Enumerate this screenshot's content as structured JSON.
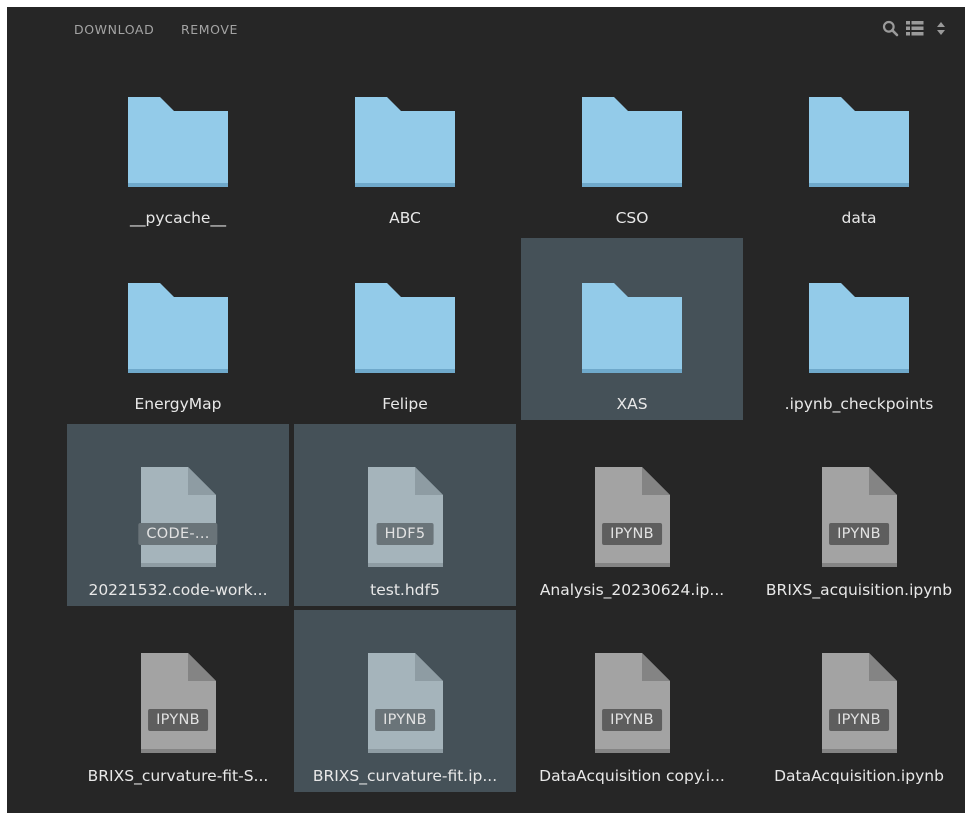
{
  "toolbar": {
    "download_label": "DOWNLOAD",
    "remove_label": "REMOVE",
    "icons": [
      "search-icon",
      "list-view-icon",
      "sort-icon"
    ]
  },
  "colors": {
    "panel_bg": "#262626",
    "selected_bg": "#455158",
    "folder": "#93cbe9",
    "doc": "#a3a3a3",
    "doc_selected": "#a5b4bb"
  },
  "files": [
    {
      "name": "__pycache__",
      "type": "folder",
      "selected": false
    },
    {
      "name": "ABC",
      "type": "folder",
      "selected": false
    },
    {
      "name": "CSO",
      "type": "folder",
      "selected": false
    },
    {
      "name": "data",
      "type": "folder",
      "selected": false
    },
    {
      "name": "EnergyMap",
      "type": "folder",
      "selected": false
    },
    {
      "name": "Felipe",
      "type": "folder",
      "selected": false
    },
    {
      "name": "XAS",
      "type": "folder",
      "selected": true
    },
    {
      "name": ".ipynb_checkpoints",
      "type": "folder",
      "selected": false
    },
    {
      "name": "20221532.code-work...",
      "type": "file",
      "badge": "CODE-...",
      "selected": true
    },
    {
      "name": "test.hdf5",
      "type": "file",
      "badge": "HDF5",
      "selected": true
    },
    {
      "name": "Analysis_20230624.ip...",
      "type": "file",
      "badge": "IPYNB",
      "selected": false
    },
    {
      "name": "BRIXS_acquisition.ipynb",
      "type": "file",
      "badge": "IPYNB",
      "selected": false
    },
    {
      "name": "BRIXS_curvature-fit-S...",
      "type": "file",
      "badge": "IPYNB",
      "selected": false
    },
    {
      "name": "BRIXS_curvature-fit.ip...",
      "type": "file",
      "badge": "IPYNB",
      "selected": true
    },
    {
      "name": "DataAcquisition copy.i...",
      "type": "file",
      "badge": "IPYNB",
      "selected": false
    },
    {
      "name": "DataAcquisition.ipynb",
      "type": "file",
      "badge": "IPYNB",
      "selected": false
    }
  ]
}
